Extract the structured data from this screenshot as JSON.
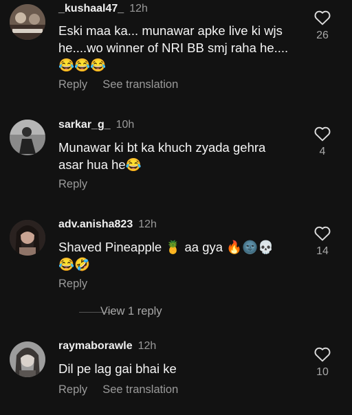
{
  "comments": [
    {
      "username": "_kushaal47_",
      "time": "12h",
      "text": "Eski maa ka... munawar apke live ki wjs he....wo winner of NRI BB smj raha he....😂😂😂",
      "likes": "26",
      "reply_label": "Reply",
      "translate_label": "See translation"
    },
    {
      "username": "sarkar_g_",
      "time": "10h",
      "text": "Munawar ki bt ka khuch zyada gehra asar hua he😂",
      "likes": "4",
      "reply_label": "Reply"
    },
    {
      "username": "adv.anisha823",
      "time": "12h",
      "text": "Shaved Pineapple 🍍 aa gya 🔥🌚💀 😂🤣",
      "likes": "14",
      "reply_label": "Reply",
      "view_replies": "View 1 reply"
    },
    {
      "username": "raymaborawle",
      "time": "12h",
      "text": "Dil pe lag gai bhai ke",
      "likes": "10",
      "reply_label": "Reply",
      "translate_label": "See translation"
    }
  ],
  "colors": {
    "background": "#121212",
    "text": "#f5f5f5",
    "muted": "#9a9a9a"
  },
  "icons": {
    "like": "heart-outline-icon"
  }
}
